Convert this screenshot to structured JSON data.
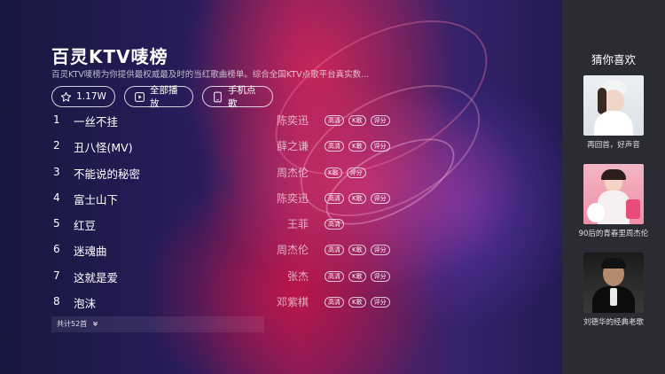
{
  "header": {
    "title": "百灵KTV唛榜",
    "subtitle": "百灵KTV唛榜为你提供最权威最及时的当红歌曲榜单。综合全国KTV点歌平台真实数..."
  },
  "actions": {
    "favorite_count": "1.17W",
    "play_all": "全部播放",
    "phone_order": "手机点歌"
  },
  "badge_labels": {
    "hd": "高清",
    "k": "K歌",
    "score": "评分"
  },
  "songs": [
    {
      "num": "1",
      "title": "一丝不挂",
      "artist": "陈奕迅",
      "badges": [
        "高清",
        "K歌",
        "评分"
      ]
    },
    {
      "num": "2",
      "title": "丑八怪(MV)",
      "artist": "薛之谦",
      "badges": [
        "高清",
        "K歌",
        "评分"
      ]
    },
    {
      "num": "3",
      "title": "不能说的秘密",
      "artist": "周杰伦",
      "badges": [
        "K歌",
        "评分"
      ]
    },
    {
      "num": "4",
      "title": "富士山下",
      "artist": "陈奕迅",
      "badges": [
        "高清",
        "K歌",
        "评分"
      ]
    },
    {
      "num": "5",
      "title": "红豆",
      "artist": "王菲",
      "badges": [
        "高清"
      ]
    },
    {
      "num": "6",
      "title": "迷魂曲",
      "artist": "周杰伦",
      "badges": [
        "高清",
        "K歌",
        "评分"
      ]
    },
    {
      "num": "7",
      "title": "这就是爱",
      "artist": "张杰",
      "badges": [
        "高清",
        "K歌",
        "评分"
      ]
    },
    {
      "num": "8",
      "title": "泡沫",
      "artist": "邓紫棋",
      "badges": [
        "高清",
        "K歌",
        "评分"
      ]
    }
  ],
  "footer": {
    "total": "共计52首"
  },
  "sidebar": {
    "title": "猜你喜欢",
    "cards": [
      {
        "caption": "再回首，好声音"
      },
      {
        "caption": "90后的青春里周杰伦"
      },
      {
        "caption": "刘德华的经典老歌"
      }
    ]
  }
}
